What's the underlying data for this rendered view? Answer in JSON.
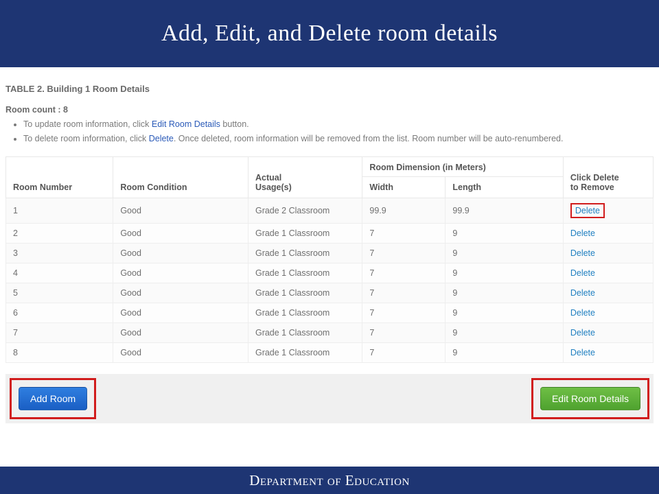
{
  "banner": {
    "title": "Add, Edit, and Delete room details"
  },
  "table_heading": "TABLE 2. Building 1 Room Details",
  "room_count_label": "Room count : 8",
  "instructions": {
    "line1_pre": "To update room information, click ",
    "line1_link": "Edit Room Details",
    "line1_post": " button.",
    "line2_pre": "To delete room information, click ",
    "line2_link": "Delete",
    "line2_post": ". Once deleted, room information will be removed from the list. Room number will be auto-renumbered."
  },
  "columns": {
    "room_number": "Room Number",
    "room_condition": "Room Condition",
    "actual_usage_l1": "Actual",
    "actual_usage_l2": "Usage(s)",
    "dim_group": "Room Dimension (in Meters)",
    "width": "Width",
    "length": "Length",
    "delete_l1": "Click Delete",
    "delete_l2": "to Remove"
  },
  "rows": [
    {
      "num": "1",
      "cond": "Good",
      "usage": "Grade 2 Classroom",
      "w": "99.9",
      "l": "99.9",
      "del": "Delete",
      "highlight": true
    },
    {
      "num": "2",
      "cond": "Good",
      "usage": "Grade 1 Classroom",
      "w": "7",
      "l": "9",
      "del": "Delete",
      "highlight": false
    },
    {
      "num": "3",
      "cond": "Good",
      "usage": "Grade 1 Classroom",
      "w": "7",
      "l": "9",
      "del": "Delete",
      "highlight": false
    },
    {
      "num": "4",
      "cond": "Good",
      "usage": "Grade 1 Classroom",
      "w": "7",
      "l": "9",
      "del": "Delete",
      "highlight": false
    },
    {
      "num": "5",
      "cond": "Good",
      "usage": "Grade 1 Classroom",
      "w": "7",
      "l": "9",
      "del": "Delete",
      "highlight": false
    },
    {
      "num": "6",
      "cond": "Good",
      "usage": "Grade 1 Classroom",
      "w": "7",
      "l": "9",
      "del": "Delete",
      "highlight": false
    },
    {
      "num": "7",
      "cond": "Good",
      "usage": "Grade 1 Classroom",
      "w": "7",
      "l": "9",
      "del": "Delete",
      "highlight": false
    },
    {
      "num": "8",
      "cond": "Good",
      "usage": "Grade 1 Classroom",
      "w": "7",
      "l": "9",
      "del": "Delete",
      "highlight": false
    }
  ],
  "buttons": {
    "add": "Add Room",
    "edit": "Edit Room Details"
  },
  "footer": {
    "text": "Department of Education"
  }
}
